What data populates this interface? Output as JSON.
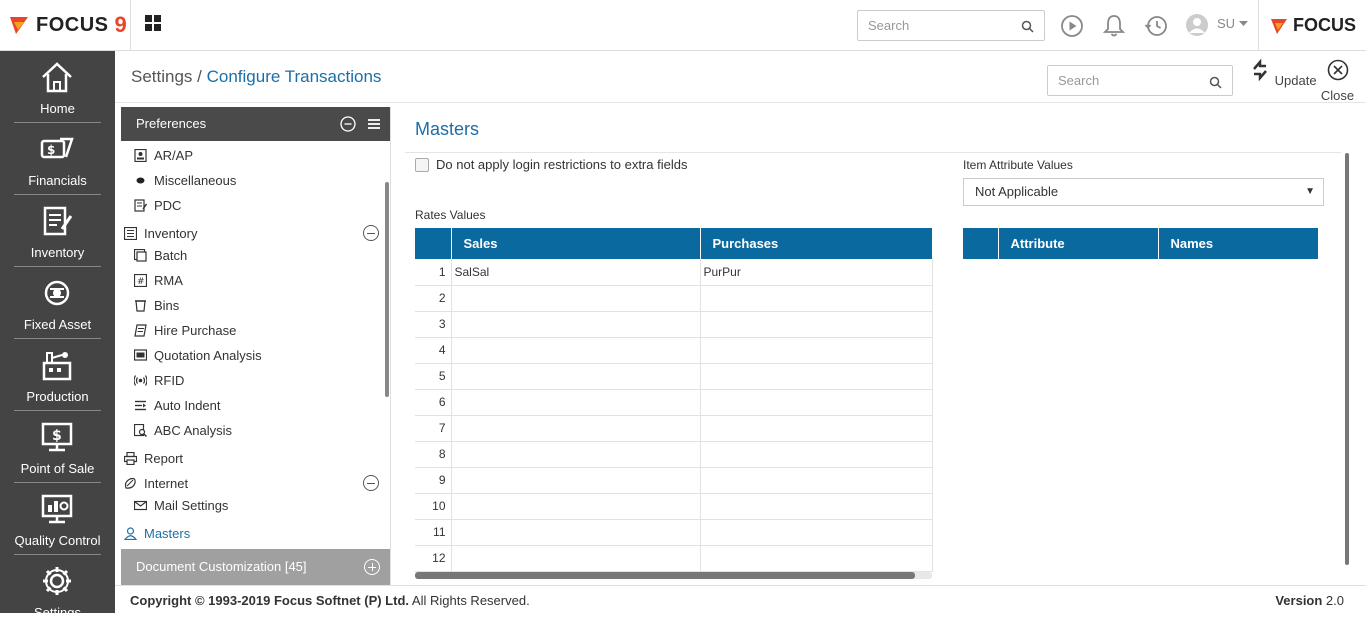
{
  "topbar": {
    "logo_text": "FOCUS",
    "logo_num": "9",
    "search_placeholder": "Search",
    "user_label": "SU",
    "brand_text": "FOCUS"
  },
  "sidebar": {
    "items": [
      {
        "label": "Home",
        "icon": "home-icon"
      },
      {
        "label": "Financials",
        "icon": "financials-icon"
      },
      {
        "label": "Inventory",
        "icon": "inventory-icon"
      },
      {
        "label": "Fixed Asset",
        "icon": "fixed-asset-icon"
      },
      {
        "label": "Production",
        "icon": "production-icon"
      },
      {
        "label": "Point of Sale",
        "icon": "point-of-sale-icon"
      },
      {
        "label": "Quality Control",
        "icon": "quality-control-icon"
      },
      {
        "label": "Settings",
        "icon": "gear-icon"
      }
    ]
  },
  "header": {
    "crumb_root": "Settings",
    "crumb_sep": " / ",
    "crumb_current": "Configure Transactions",
    "search_placeholder": "Search",
    "update_label": "Update",
    "close_label": "Close"
  },
  "left_panel": {
    "title": "Preferences",
    "items": [
      {
        "label": "AR/AP",
        "level": 2
      },
      {
        "label": "Miscellaneous",
        "level": 2
      },
      {
        "label": "PDC",
        "level": 2
      },
      {
        "label": "Inventory",
        "level": 1
      },
      {
        "label": "Batch",
        "level": 2
      },
      {
        "label": "RMA",
        "level": 2
      },
      {
        "label": "Bins",
        "level": 2
      },
      {
        "label": "Hire Purchase",
        "level": 2
      },
      {
        "label": "Quotation Analysis",
        "level": 2
      },
      {
        "label": "RFID",
        "level": 2
      },
      {
        "label": "Auto Indent",
        "level": 2
      },
      {
        "label": "ABC Analysis",
        "level": 2
      },
      {
        "label": "Report",
        "level": 1
      },
      {
        "label": "Internet",
        "level": 1
      },
      {
        "label": "Mail Settings",
        "level": 2
      },
      {
        "label": "Masters",
        "level": 1
      }
    ],
    "doc_customization": "Document Customization [45]"
  },
  "main": {
    "title": "Masters",
    "checkbox_label": "Do not apply login restrictions to extra fields",
    "item_attr_label": "Item Attribute Values",
    "item_attr_value": "Not Applicable",
    "rates_label": "Rates Values",
    "rates_headers": [
      "Sales",
      "Purchases"
    ],
    "rates_rows": [
      {
        "n": "1",
        "sales": "SalSal",
        "purchases": "PurPur"
      },
      {
        "n": "2",
        "sales": "",
        "purchases": ""
      },
      {
        "n": "3",
        "sales": "",
        "purchases": ""
      },
      {
        "n": "4",
        "sales": "",
        "purchases": ""
      },
      {
        "n": "5",
        "sales": "",
        "purchases": ""
      },
      {
        "n": "6",
        "sales": "",
        "purchases": ""
      },
      {
        "n": "7",
        "sales": "",
        "purchases": ""
      },
      {
        "n": "8",
        "sales": "",
        "purchases": ""
      },
      {
        "n": "9",
        "sales": "",
        "purchases": ""
      },
      {
        "n": "10",
        "sales": "",
        "purchases": ""
      },
      {
        "n": "11",
        "sales": "",
        "purchases": ""
      },
      {
        "n": "12",
        "sales": "",
        "purchases": ""
      }
    ],
    "attr_headers": [
      "Attribute",
      "Names"
    ]
  },
  "footer": {
    "copyright_bold": "Copyright © 1993-2019 Focus Softnet (P) Ltd.",
    "copyright_rest": " All Rights Reserved.",
    "version_bold": "Version",
    "version_num": " 2.0"
  }
}
